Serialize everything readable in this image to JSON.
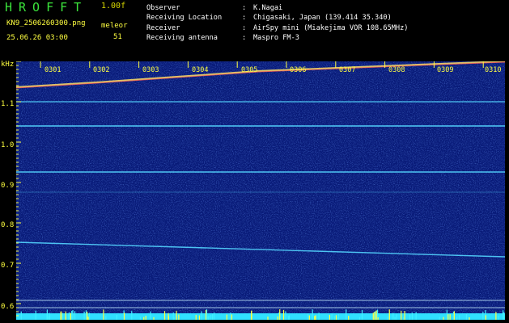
{
  "header": {
    "app_title": "HROFFT",
    "version": "1.00f",
    "filename": "KN9_2506260300.png",
    "datetime": "25.06.26 03:00",
    "meteor_label": "meleor",
    "meteor_count": "51"
  },
  "info": {
    "rows": [
      {
        "key": "Observer",
        "sep": ":",
        "value": "K.Nagai"
      },
      {
        "key": "Receiving Location",
        "sep": ":",
        "value": "Chigasaki, Japan (139.414 35.340)"
      },
      {
        "key": "Receiver",
        "sep": ":",
        "value": "AirSpy mini (Miakejima VOR 108.65MHz)"
      },
      {
        "key": "Receiving antenna",
        "sep": ":",
        "value": "Maspro FM-3"
      }
    ]
  },
  "chart_data": {
    "type": "heatmap",
    "ylabel": "kHz",
    "y_ticks": [
      "1.1",
      "1.0",
      "0.9",
      "0.8",
      "0.7",
      "0.6"
    ],
    "x_ticks": [
      "0301",
      "0302",
      "0303",
      "0304",
      "0305",
      "0306",
      "0307",
      "0308",
      "0309",
      "0310"
    ],
    "colors": {
      "background": "#0a1a6e",
      "trace": "#40e0ff",
      "tick": "#ffff40"
    }
  }
}
